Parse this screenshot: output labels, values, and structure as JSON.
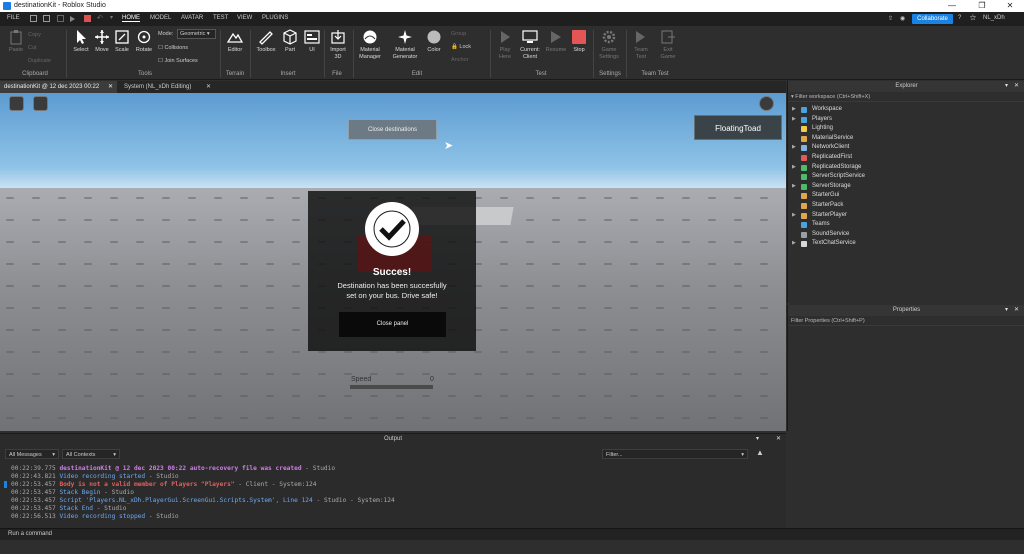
{
  "window": {
    "title": "destinationKit - Roblox Studio",
    "controls": [
      "minimize",
      "restore",
      "close"
    ]
  },
  "menubar": {
    "file": "FILE",
    "tabs": [
      "HOME",
      "MODEL",
      "AVATAR",
      "TEST",
      "VIEW",
      "PLUGINS"
    ],
    "active_tab": "HOME",
    "collaborate": "Collaborate",
    "user": "NL_xDh"
  },
  "ribbon": {
    "clipboard": {
      "paste": "Paste",
      "copy": "Copy",
      "cut": "Cut",
      "duplicate": "Duplicate",
      "group": "Clipboard"
    },
    "tools": {
      "select": "Select",
      "move": "Move",
      "scale": "Scale",
      "rotate": "Rotate",
      "mode_label": "Mode:",
      "mode_value": "Geometric",
      "collisions": "Collisions",
      "join_surfaces": "Join Surfaces",
      "group": "Tools"
    },
    "terrain": {
      "editor": "Editor",
      "group": "Terrain"
    },
    "insert": {
      "toolbox": "Toolbox",
      "part": "Part",
      "ui": "UI",
      "group": "Insert"
    },
    "file": {
      "import3d": "Import 3D",
      "group": "File"
    },
    "edit": {
      "material_manager": "Material Manager",
      "material_generator": "Material Generator",
      "color": "Color",
      "group_btn": "Group",
      "lock": "Lock",
      "anchor": "Anchor",
      "group": "Edit"
    },
    "test": {
      "play_here": "Play Here",
      "current_client": "Current: Client",
      "resume": "Resume",
      "stop": "Stop",
      "group": "Test"
    },
    "settings": {
      "game_settings": "Game Settings",
      "group": "Settings"
    },
    "team_test": {
      "team_test": "Team Test",
      "exit_game": "Exit Game",
      "group": "Team Test"
    }
  },
  "doc_tabs": [
    "destinationKit @ 12 dec 2023 00:22",
    "System (NL_xDh Editing)"
  ],
  "viewport": {
    "close_destinations": "Close destinations",
    "player_name": "FloatingToad",
    "panel": {
      "title": "Succes!",
      "message": "Destination has been succesfully set on your bus. Drive safe!",
      "close_button": "Close panel"
    },
    "speed_label": "Speed",
    "speed_value": "0"
  },
  "explorer": {
    "title": "Explorer",
    "filter": "Filter workspace (Ctrl+Shift+X)",
    "items": [
      {
        "label": "Workspace",
        "color": "#4aa3df",
        "expandable": true
      },
      {
        "label": "Players",
        "color": "#4aa3df",
        "expandable": true
      },
      {
        "label": "Lighting",
        "color": "#f2c94c",
        "expandable": false
      },
      {
        "label": "MaterialService",
        "color": "#e2a64a",
        "expandable": false
      },
      {
        "label": "NetworkClient",
        "color": "#7fb4e6",
        "expandable": true
      },
      {
        "label": "ReplicatedFirst",
        "color": "#e05a5a",
        "expandable": false
      },
      {
        "label": "ReplicatedStorage",
        "color": "#4dbb6a",
        "expandable": true
      },
      {
        "label": "ServerScriptService",
        "color": "#4dbb6a",
        "expandable": false
      },
      {
        "label": "ServerStorage",
        "color": "#4dbb6a",
        "expandable": true
      },
      {
        "label": "StarterGui",
        "color": "#e2a64a",
        "expandable": false
      },
      {
        "label": "StarterPack",
        "color": "#e2a64a",
        "expandable": false
      },
      {
        "label": "StarterPlayer",
        "color": "#e2a64a",
        "expandable": true
      },
      {
        "label": "Teams",
        "color": "#4aa3df",
        "expandable": false
      },
      {
        "label": "SoundService",
        "color": "#9aa0a6",
        "expandable": false
      },
      {
        "label": "TextChatService",
        "color": "#d8d8d8",
        "expandable": true
      }
    ]
  },
  "properties": {
    "title": "Properties",
    "filter": "Filter Properties (Ctrl+Shift+P)"
  },
  "output": {
    "title": "Output",
    "messages_dd": "All Messages",
    "contexts_dd": "All Contexts",
    "filter_placeholder": "Filter...",
    "logs": [
      {
        "time": "00:22:39.775",
        "text": "destinationKit @ 12 dec 2023 00:22 auto-recovery file was created",
        "suffix": " - Studio",
        "style": "purple"
      },
      {
        "time": "00:22:43.821",
        "text": "Video recording started",
        "suffix": " - Studio",
        "style": "blue"
      },
      {
        "time": "00:22:53.457",
        "text": "Body is not a valid member of Players \"Players\"",
        "suffix": " - Client - System:124",
        "style": "red"
      },
      {
        "time": "00:22:53.457",
        "text": "Stack Begin",
        "suffix": " - Studio",
        "style": "blue"
      },
      {
        "time": "00:22:53.457",
        "text": "Script 'Players.NL_xDh.PlayerGui.ScreenGui.Scripts.System', Line 124",
        "suffix": " - Studio - System:124",
        "style": "blue"
      },
      {
        "time": "00:22:53.457",
        "text": "Stack End",
        "suffix": " - Studio",
        "style": "blue"
      },
      {
        "time": "00:22:56.513",
        "text": "Video recording stopped",
        "suffix": " - Studio",
        "style": "blue"
      }
    ]
  },
  "command_bar": {
    "placeholder": "Run a command"
  }
}
